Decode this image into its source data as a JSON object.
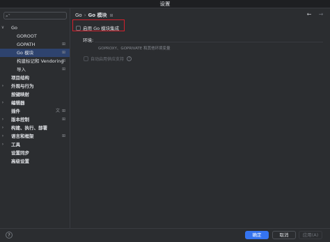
{
  "window": {
    "title": "设置"
  },
  "search": {
    "placeholder": "",
    "icon": "search-icon"
  },
  "sidebar": {
    "items": [
      {
        "label": "Go",
        "level": 0,
        "expanded": true,
        "chevron": "∨"
      },
      {
        "label": "GOROOT",
        "level": 1
      },
      {
        "label": "GOPATH",
        "level": 1,
        "mark": "⊞"
      },
      {
        "label": "Go 模块",
        "level": 1,
        "selected": true,
        "mark": "⊞"
      },
      {
        "label": "构建标记和 Vendoring",
        "level": 1,
        "mark": "⊞"
      },
      {
        "label": "导入",
        "level": 1,
        "mark": "⊞"
      },
      {
        "label": "项目结构",
        "level": 0,
        "bold": true
      },
      {
        "label": "外观与行为",
        "level": 0,
        "bold": true,
        "chevron": "›"
      },
      {
        "label": "按键映射",
        "level": 0,
        "bold": true
      },
      {
        "label": "编辑器",
        "level": 0,
        "bold": true,
        "chevron": "›"
      },
      {
        "label": "插件",
        "level": 0,
        "bold": true,
        "mark": "⊞",
        "mark2": "文"
      },
      {
        "label": "版本控制",
        "level": 0,
        "bold": true,
        "chevron": "›",
        "mark": "⊞"
      },
      {
        "label": "构建、执行、部署",
        "level": 0,
        "bold": true,
        "chevron": "›"
      },
      {
        "label": "语言和框架",
        "level": 0,
        "bold": true,
        "chevron": "›",
        "mark": "⊞"
      },
      {
        "label": "工具",
        "level": 0,
        "bold": true,
        "chevron": "›"
      },
      {
        "label": "设置同步",
        "level": 0,
        "bold": true
      },
      {
        "label": "高级设置",
        "level": 0,
        "bold": true
      }
    ]
  },
  "breadcrumb": {
    "parent": "Go",
    "separator": "›",
    "current": "Go 模块",
    "pin_mark": "⊞"
  },
  "nav": {
    "back": "←",
    "forward": "→"
  },
  "go_modules": {
    "enable_label": "启用 Go 模块集成",
    "enable_checked": false,
    "env_label": "环境:",
    "env_value": "",
    "env_hint": "GOPROXY、GOPRIVATE 和其他环境变量",
    "vendoring_label": "自动启用供应支持",
    "vendoring_enabled": false,
    "help_icon": "?"
  },
  "footer": {
    "help": "?",
    "ok": "确定",
    "cancel": "取消",
    "apply": "应用(A)"
  },
  "colors": {
    "accent": "#3574f0",
    "selection": "#2e436e",
    "highlight_border": "#d4202c",
    "background": "#2b2d30"
  }
}
